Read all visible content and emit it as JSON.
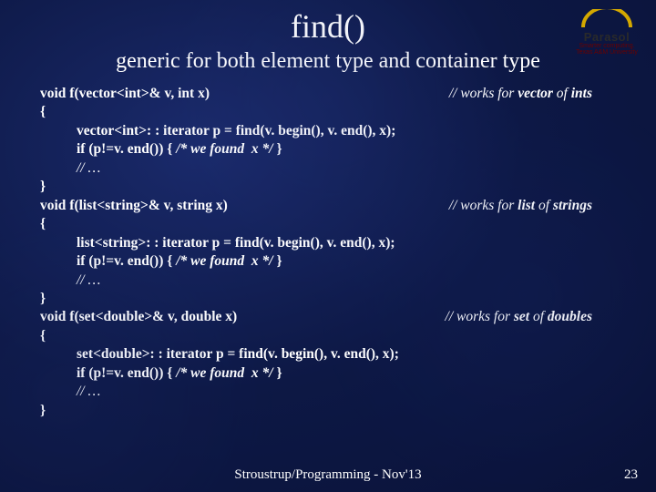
{
  "title": "find()",
  "subtitle": "generic for both element type and container type",
  "logo": {
    "name": "Parasol",
    "sub1": "Smarter computing.",
    "sub2": "Texas A&M University"
  },
  "blocks": [
    {
      "sig_pre": "void f(vector<int>& v, int x)",
      "sig_comment_pre": "// works for ",
      "sig_comment_b1": "vector",
      "sig_comment_mid": " of ",
      "sig_comment_b2": "ints",
      "open": "{",
      "line1": "vector<int>: : iterator p = find(v. begin(), v. end(), x);",
      "line2_pre": "if (p!=v. end()) { ",
      "line2_ital": "/* we found  x */",
      "line2_post": " }",
      "line3": "// …",
      "close": "}"
    },
    {
      "sig_pre": "void f(list<string>& v, string x)",
      "sig_comment_pre": "// works for ",
      "sig_comment_b1": "list",
      "sig_comment_mid": " of ",
      "sig_comment_b2": "strings",
      "open": "{",
      "line1": "list<string>: : iterator p = find(v. begin(), v. end(), x);",
      "line2_pre": "if (p!=v. end()) { ",
      "line2_ital": "/* we found  x */",
      "line2_post": " }",
      "line3": "// …",
      "close": "}"
    },
    {
      "sig_pre": "void f(set<double>& v, double x)",
      "sig_comment_pre": "// works for ",
      "sig_comment_b1": "set",
      "sig_comment_mid": " of ",
      "sig_comment_b2": "doubles",
      "open": "{",
      "line1": "set<double>: : iterator p = find(v. begin(), v. end(), x);",
      "line2_pre": "if (p!=v. end()) { ",
      "line2_ital": "/* we found  x */",
      "line2_post": " }",
      "line3": "// …",
      "close": "}"
    }
  ],
  "footer": "Stroustrup/Programming - Nov'13",
  "pagenum": "23"
}
